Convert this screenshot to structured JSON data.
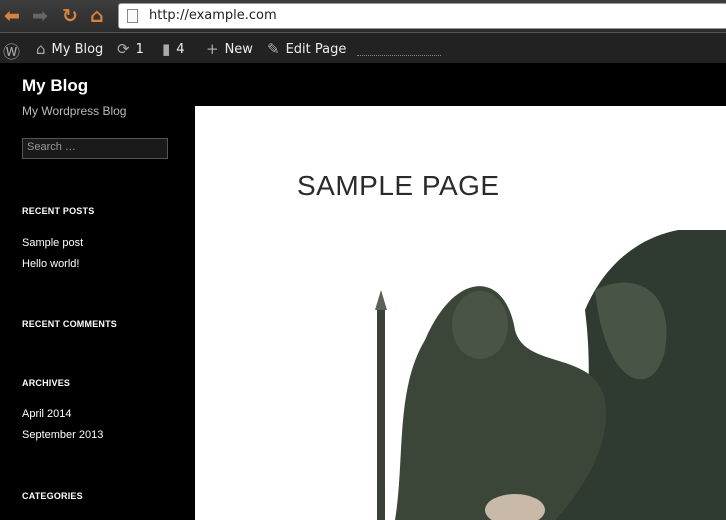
{
  "browser": {
    "url": "http://example.com",
    "back_icon": "arrow-left",
    "forward_icon": "arrow-right",
    "reload_icon": "reload",
    "home_icon": "home"
  },
  "adminbar": {
    "wp_icon": "wordpress-logo",
    "site": "My Blog",
    "updates": "1",
    "comments": "4",
    "new": "New",
    "edit": "Edit Page"
  },
  "sidebar": {
    "title": "My Blog",
    "tagline": "My Wordpress Blog",
    "search_placeholder": "Search …",
    "recent_posts": {
      "title": "RECENT POSTS",
      "items": [
        "Sample post",
        "Hello world!"
      ]
    },
    "recent_comments": {
      "title": "RECENT COMMENTS"
    },
    "archives": {
      "title": "ARCHIVES",
      "items": [
        "April 2014",
        "September 2013"
      ]
    },
    "categories": {
      "title": "CATEGORIES"
    }
  },
  "page": {
    "title": "SAMPLE PAGE"
  },
  "colors": {
    "nav_icon": "#d9823b",
    "adminbar": "#222222",
    "sidebar": "#000000"
  }
}
